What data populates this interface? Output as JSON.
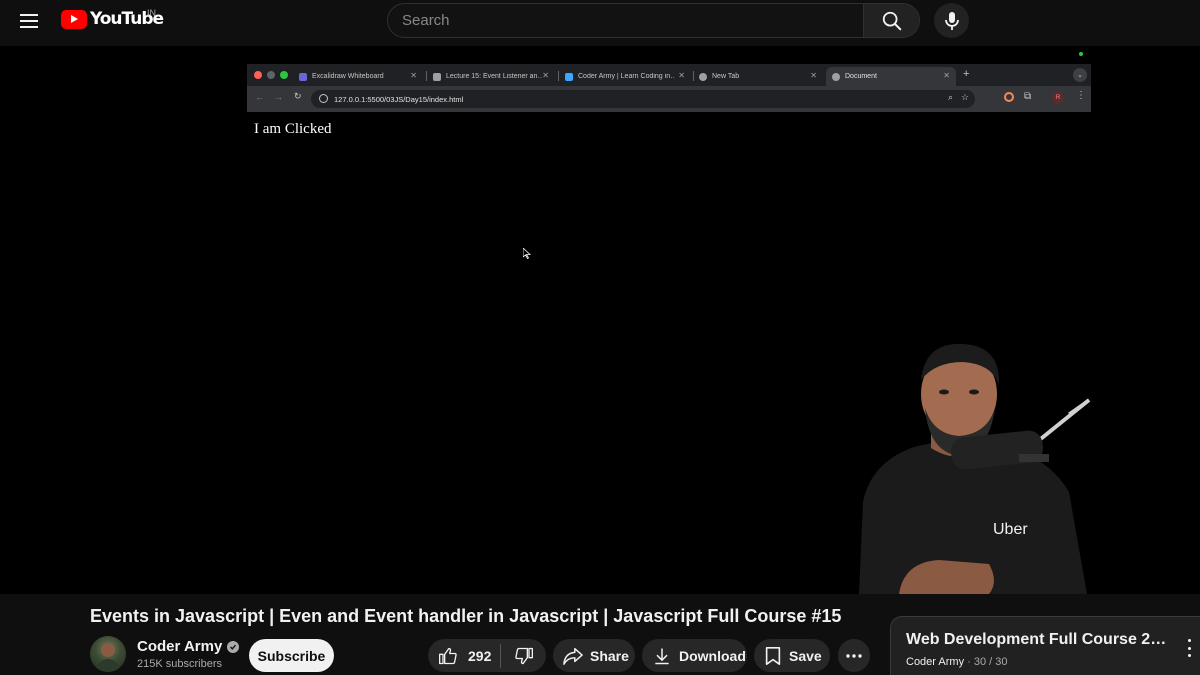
{
  "header": {
    "logo_text": "YouTube",
    "region": "IN",
    "search_placeholder": "Search"
  },
  "browser": {
    "tabs": [
      {
        "label": "Excalidraw Whiteboard",
        "favicon_color": "#6965db"
      },
      {
        "label": "Lecture 15: Event Listener an…",
        "favicon_color": "#9aa0a6"
      },
      {
        "label": "Coder Army | Learn Coding in…",
        "favicon_color": "#3ea6ff"
      },
      {
        "label": "New Tab",
        "favicon_color": "#9aa0a6"
      },
      {
        "label": "Document",
        "favicon_color": "#9aa0a6"
      }
    ],
    "url": "127.0.0.1:5500/03JS/Day15/index.html",
    "page_text": "I am Clicked",
    "profile_letter": "R",
    "shirt_logo": "Uber"
  },
  "video": {
    "title": "Events in Javascript | Even and Event handler in Javascript | Javascript Full Course #15"
  },
  "channel": {
    "name": "Coder Army",
    "subscribers": "215K subscribers",
    "subscribe_label": "Subscribe"
  },
  "actions": {
    "likes": "292",
    "share_label": "Share",
    "download_label": "Download",
    "save_label": "Save"
  },
  "playlist": {
    "title": "Web Development Full Course 2…",
    "channel": "Coder Army",
    "separator": "·",
    "position": "30 / 30"
  },
  "colors": {
    "brand_red": "#ff0000",
    "background": "#0f0f0f",
    "button_bg": "#272727"
  }
}
